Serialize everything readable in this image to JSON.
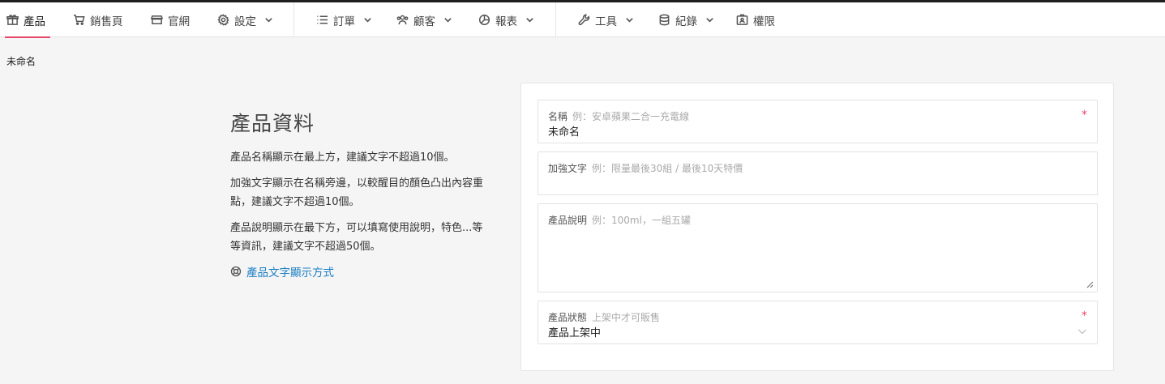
{
  "nav": {
    "items": [
      {
        "label": "產品",
        "icon": "gift-icon",
        "active": true,
        "dropdown": false
      },
      {
        "label": "銷售頁",
        "icon": "cart-icon",
        "active": false,
        "dropdown": false
      },
      {
        "label": "官網",
        "icon": "store-icon",
        "active": false,
        "dropdown": false
      },
      {
        "label": "設定",
        "icon": "gear-icon",
        "active": false,
        "dropdown": true
      },
      {
        "label": "訂單",
        "icon": "list-icon",
        "active": false,
        "dropdown": true
      },
      {
        "label": "顧客",
        "icon": "users-icon",
        "active": false,
        "dropdown": true
      },
      {
        "label": "報表",
        "icon": "pie-chart-icon",
        "active": false,
        "dropdown": true
      },
      {
        "label": "工具",
        "icon": "wrench-icon",
        "active": false,
        "dropdown": true
      },
      {
        "label": "紀錄",
        "icon": "database-icon",
        "active": false,
        "dropdown": true
      },
      {
        "label": "權限",
        "icon": "id-badge-icon",
        "active": false,
        "dropdown": false
      }
    ],
    "accent_color": "#e8456b"
  },
  "breadcrumb": "未命名",
  "info": {
    "title": "產品資料",
    "paragraphs": [
      "產品名稱顯示在最上方，建議文字不超過10個。",
      "加強文字顯示在名稱旁邊，以較醒目的顏色凸出內容重點，建議文字不超過10個。",
      "產品說明顯示在最下方，可以填寫使用說明，特色...等等資訊，建議文字不超過50個。"
    ],
    "help_link": "產品文字顯示方式",
    "link_color": "#1a7fc1"
  },
  "form": {
    "name": {
      "label": "名稱",
      "placeholder": "例：安卓蘋果二合一充電線",
      "value": "未命名",
      "required_mark": "*"
    },
    "highlight": {
      "label": "加強文字",
      "placeholder": "例：限量最後30組 / 最後10天特價",
      "value": ""
    },
    "description": {
      "label": "產品說明",
      "placeholder": "例：100ml，一組五罐",
      "value": ""
    },
    "status": {
      "label": "產品狀態",
      "placeholder": "上架中才可販售",
      "value": "產品上架中",
      "required_mark": "*"
    }
  }
}
